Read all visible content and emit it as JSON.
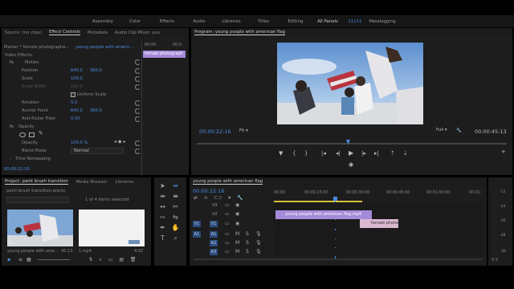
{
  "workspaces": [
    "Assembly",
    "Color",
    "Effects",
    "Audio",
    "Libraries",
    "Titles",
    "Editing",
    "All Panels",
    "Metalogging"
  ],
  "workspaces_active": "All Panels",
  "workspace_extra": "11111",
  "source_tabs": [
    "Source: (no clips)",
    "Effect Controls",
    "Metadata",
    "Audio Clip Mixer: you"
  ],
  "source_active_tab": "Effect Controls",
  "effect_controls": {
    "master": "Master * female photographe...",
    "clip": "young people with americ...",
    "ruler_start": "00:00",
    "ruler_end": "00:0",
    "clip_bar_label": "female photograph",
    "video_effects_label": "Video Effects",
    "motion_label": "Motion",
    "position_label": "Position",
    "position_x": "640.0",
    "position_y": "360.0",
    "scale_label": "Scale",
    "scale_value": "100.0",
    "scale_width_label": "Scale Width",
    "scale_width_value": "100.0",
    "uniform_scale_label": "Uniform Scale",
    "rotation_label": "Rotation",
    "rotation_value": "0.0",
    "anchor_label": "Anchor Point",
    "anchor_x": "640.0",
    "anchor_y": "360.0",
    "antiflicker_label": "Anti-flicker Filter",
    "antiflicker_value": "0.00",
    "opacity_group_label": "Opacity",
    "opacity_label": "Opacity",
    "opacity_value": "100.0 %",
    "blend_label": "Blend Mode",
    "blend_value": "Normal",
    "time_remap_label": "Time Remapping",
    "timecode": "00:00:22:16"
  },
  "program": {
    "title": "Program: young people with american flag",
    "timecode": "00:00:22:16",
    "fit": "Fit",
    "quality": "Full",
    "duration": "00:00:45:13"
  },
  "project": {
    "tabs": [
      "Project: paint brush transition",
      "Media Browser",
      "Libraries"
    ],
    "active_tab": "Project: paint brush transition",
    "file": "paint brush transition.prproj",
    "items_selected": "1 of 4 items selected",
    "items": [
      {
        "name": "young people with ame...",
        "duration": "45:13"
      },
      {
        "name": "1.mp4",
        "duration": "4:02"
      }
    ]
  },
  "timeline": {
    "title": "young people with american flag",
    "timecode": "00:00:22:16",
    "ruler": [
      "00:00",
      "00:00:15:00",
      "00:00:30:00",
      "00:00:45:00",
      "00:01:00:00",
      "00:01:"
    ],
    "tracks_video": [
      "V3",
      "V2",
      "V1"
    ],
    "tracks_audio": [
      "A1",
      "A2",
      "A3"
    ],
    "clip_v1": "young people with american flag.mp4",
    "clip_v2": "female photog",
    "meter_labels": [
      "-12",
      "-24",
      "-36",
      "-48",
      "dB"
    ]
  },
  "colors": {
    "accent": "#4a8ce0",
    "clip_purple": "#a58ad9",
    "clip_pink": "#d9b8d0",
    "track_blue": "#2b4c7e"
  }
}
